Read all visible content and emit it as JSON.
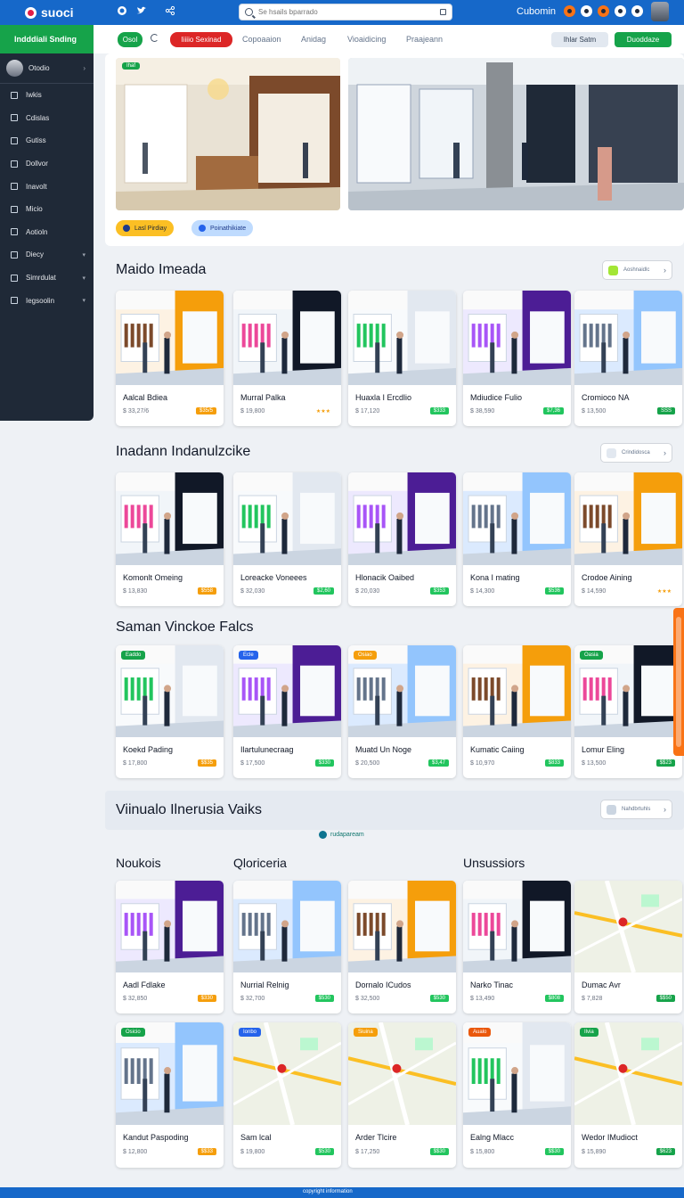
{
  "app": {
    "name": "suoci"
  },
  "topbar": {
    "search_placeholder": "Se hsails bparrado",
    "user_label": "Cubomin"
  },
  "sidebar": {
    "header": "Indddiali Snding",
    "user": "Otodio",
    "items": [
      {
        "label": "Iwkis",
        "icon": "square-icon"
      },
      {
        "label": "Cdislas",
        "icon": "pen-icon"
      },
      {
        "label": "Gutiss",
        "icon": "pen-icon"
      },
      {
        "label": "Dollvor",
        "icon": "tag-icon"
      },
      {
        "label": "Inavolt",
        "icon": "box-icon"
      },
      {
        "label": "Micio",
        "icon": "doc-icon"
      },
      {
        "label": "Aotioln",
        "icon": "doc-icon"
      },
      {
        "label": "Diecy",
        "icon": "grid-icon",
        "expandable": true
      },
      {
        "label": "Simrdulat",
        "icon": "grid-icon",
        "expandable": true
      },
      {
        "label": "Iegsoolin",
        "icon": "grid-icon",
        "expandable": true
      }
    ]
  },
  "filters": {
    "chip1": "Osol",
    "chip2": "Iiiiio Sexinad",
    "tabs": [
      "Copoaaion",
      "Anidag",
      "Vioaidicing",
      "Praajeann"
    ],
    "right1": "Ihlar Satm",
    "right2": "Duoddaze"
  },
  "hero": {
    "badge": "Ihaf",
    "pill1": "Lasl Pirdiay",
    "pill2": "Poinathikiate"
  },
  "sections": [
    {
      "title": "Maido Imeada",
      "link": "Aoshnaidlc",
      "cards": [
        {
          "name": "Aalcal Bdiea",
          "price": "$ 33,27/6",
          "badge": "$35/5"
        },
        {
          "name": "Murral Palka",
          "price": "$ 19,800",
          "badge": "★★★"
        },
        {
          "name": "Huaxla I Ercdlio",
          "price": "$ 17,120",
          "badge": "$333"
        },
        {
          "name": "Mdiudice Fulio",
          "price": "$ 38,590",
          "badge": "$7,36"
        },
        {
          "name": "Cromioco NA",
          "price": "$ 13,500",
          "badge": "SSS"
        }
      ]
    },
    {
      "title": "Inadann Indanulzcike",
      "link": "Crindidosca",
      "cards": [
        {
          "name": "Komonlt Omeing",
          "price": "$ 13,830",
          "badge": "$558"
        },
        {
          "name": "Loreacke Voneees",
          "price": "$ 32,030",
          "badge": "$2,60"
        },
        {
          "name": "Hlonacik Oaibed",
          "price": "$ 20,030",
          "badge": "$353"
        },
        {
          "name": "Kona I mating",
          "price": "$ 14,300",
          "badge": "$536"
        },
        {
          "name": "Crodoe Aining",
          "price": "$ 14,590",
          "badge": "★★★"
        }
      ]
    },
    {
      "title": "Saman Vinckoe Falcs",
      "cards": [
        {
          "name": "Koekd Pading",
          "price": "$ 17,800",
          "badge": "$$35",
          "tag": "Eaddo"
        },
        {
          "name": "Ilartulunecraag",
          "price": "$ 17,500",
          "badge": "$330",
          "tag": "Ecle"
        },
        {
          "name": "Muatd Un Noge",
          "price": "$ 20,500",
          "badge": "$3,47",
          "tag": "Osiao"
        },
        {
          "name": "Kumatic Caiing",
          "price": "$ 10,970",
          "badge": "$833",
          "tag": ""
        },
        {
          "name": "Lomur Eling",
          "price": "$ 13,500",
          "badge": "$$23",
          "tag": "Oasia"
        }
      ]
    },
    {
      "title": "Viinualo Ilnerusia Vaiks",
      "link": "Nahdbrtuhls",
      "subnote": "rudapaream",
      "headers": [
        "Noukois",
        "Qloriceria",
        "Unsussiors"
      ],
      "cards": [
        {
          "name": "Aadl Fdlake",
          "price": "$ 32,850",
          "badge": "$330"
        },
        {
          "name": "Nurrial Relnig",
          "price": "$ 32,700",
          "badge": "$530"
        },
        {
          "name": "Dornalo ICudos",
          "price": "$ 32,500",
          "badge": "$530"
        },
        {
          "name": "Narko Tinac",
          "price": "$ 13,490",
          "badge": "$808"
        },
        {
          "name": "Dumac Avr",
          "price": "$ 7,828",
          "badge": "$$50"
        }
      ]
    },
    {
      "cards": [
        {
          "name": "Kandut Paspoding",
          "price": "$ 12,800",
          "badge": "$$33",
          "tag": "Osicio"
        },
        {
          "name": "Sam lcal",
          "price": "$ 19,800",
          "badge": "$530",
          "tag": "Ionbo"
        },
        {
          "name": "Arder Tlcire",
          "price": "$ 17,250",
          "badge": "$$30",
          "tag": "Siuina"
        },
        {
          "name": "Ealng Mlacc",
          "price": "$ 15,800",
          "badge": "$$30",
          "tag": "Aualo"
        },
        {
          "name": "Wedor IMudioct",
          "price": "$ 15,890",
          "badge": "$623",
          "tag": "Ilvia"
        }
      ]
    }
  ],
  "footer": "copyright information"
}
